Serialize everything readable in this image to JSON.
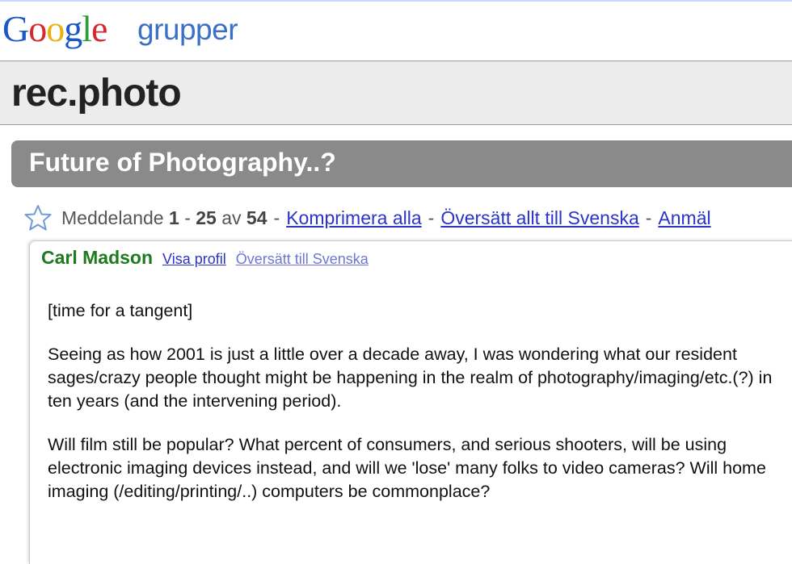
{
  "brand": {
    "google": "Google",
    "product": "grupper"
  },
  "group": {
    "name": "rec.photo"
  },
  "thread": {
    "title": "Future of Photography..?"
  },
  "meta": {
    "message_prefix": "Meddelande",
    "range_start": "1",
    "dash": "-",
    "range_end": "25",
    "of_word": "av",
    "total": "54",
    "collapse_all": "Komprimera alla",
    "translate_all": "Översätt allt till Svenska",
    "report": "Anmäl"
  },
  "post": {
    "author": "Carl Madson",
    "view_profile": "Visa profil",
    "translate": "Översätt till Svenska",
    "paragraphs": [
      "[time for a tangent]",
      "Seeing as how 2001 is just a little over a decade away, I was wondering what our resident sages/crazy people thought might be happening in the realm of photography/imaging/etc.(?) in ten years (and the intervening period).",
      "Will film still be popular? What percent of consumers, and serious shooters, will be using electronic imaging devices instead, and will we 'lose' many folks to video cameras? Will home imaging (/editing/printing/..) computers be commonplace?"
    ]
  },
  "icons": {
    "star": "star-outline-icon"
  },
  "colors": {
    "link": "#2a34c9",
    "author": "#1f7a1f",
    "thread_bar": "#8a8a8a",
    "product": "#3b70c4"
  }
}
